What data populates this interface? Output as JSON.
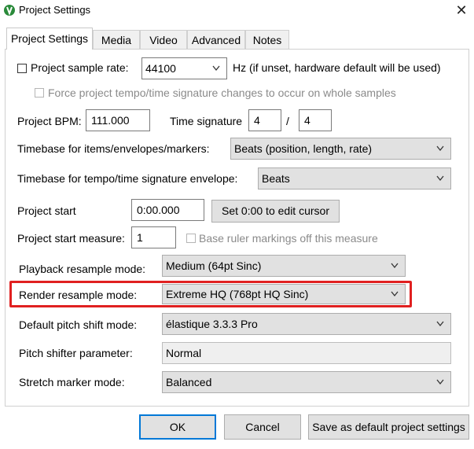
{
  "window": {
    "title": "Project Settings",
    "close_glyph": "✕"
  },
  "tabs": [
    {
      "label": "Project Settings",
      "active": true
    },
    {
      "label": "Media"
    },
    {
      "label": "Video"
    },
    {
      "label": "Advanced"
    },
    {
      "label": "Notes"
    }
  ],
  "sample_rate": {
    "label": "Project sample rate:",
    "checked": false,
    "value": "44100",
    "hint": "Hz (if unset, hardware default will be used)"
  },
  "force_tempo": {
    "label": "Force project tempo/time signature changes to occur on whole samples",
    "checked": false,
    "enabled": false
  },
  "bpm": {
    "label": "Project BPM:",
    "value": "111.000"
  },
  "time_signature": {
    "label": "Time signature",
    "numerator": "4",
    "separator": "/",
    "denominator": "4"
  },
  "timebase_items": {
    "label": "Timebase for items/envelopes/markers:",
    "value": "Beats (position, length, rate)"
  },
  "timebase_tempo": {
    "label": "Timebase for tempo/time signature envelope:",
    "value": "Beats"
  },
  "project_start": {
    "label": "Project start",
    "value": "0:00.000",
    "button": "Set 0:00 to edit cursor"
  },
  "start_measure": {
    "label": "Project start measure:",
    "value": "1",
    "base_ruler_label": "Base ruler markings off this measure",
    "base_ruler_checked": false
  },
  "playback_resample": {
    "label": "Playback resample mode:",
    "value": "Medium (64pt Sinc)"
  },
  "render_resample": {
    "label": "Render resample mode:",
    "value": "Extreme HQ (768pt HQ Sinc)",
    "highlight_color": "#e02020"
  },
  "pitch_shift": {
    "label": "Default pitch shift mode:",
    "value": "élastique 3.3.3 Pro"
  },
  "pitch_param": {
    "label": "Pitch shifter parameter:",
    "value": "Normal"
  },
  "stretch_marker": {
    "label": "Stretch marker mode:",
    "value": "Balanced"
  },
  "buttons": {
    "ok": "OK",
    "cancel": "Cancel",
    "save_default": "Save as default project settings"
  },
  "colors": {
    "accent": "#0078d7",
    "highlight": "#e02020"
  }
}
